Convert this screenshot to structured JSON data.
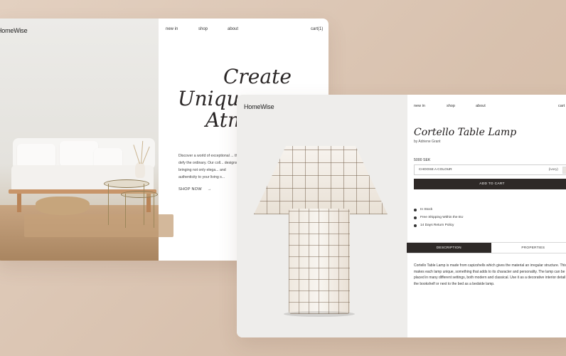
{
  "home": {
    "brand": "HomeWise",
    "nav": {
      "new_in": "new in",
      "shop": "shop",
      "about": "about",
      "cart": "cart(1)"
    },
    "headline": {
      "line1": "Create",
      "line2": "Unique",
      "line3": "Atm"
    },
    "body": "Discover a world of exceptional ... that defy the ordinary. Our coll... designs, bringing not only elega... and authenticity to your living s...",
    "shop_now": "SHOP NOW",
    "arrow_icon": "arrow-right-icon"
  },
  "product": {
    "brand": "HomeWise",
    "nav": {
      "new_in": "new in",
      "shop": "shop",
      "about": "about",
      "cart": "cart"
    },
    "title": "Cortello Table Lamp",
    "author": "by Adriene Grant",
    "price": "5000 SEK",
    "colour_select": {
      "label": "CHOOSE A COLOUR",
      "selected": "(ivory)"
    },
    "add_to_cart": "ADD TO CART",
    "features": [
      "In Stock",
      "Free Shipping Within the EU",
      "14 Days Return Policy"
    ],
    "tabs": [
      "DESCRIPTION",
      "PROPERTIES"
    ],
    "active_tab": "DESCRIPTION",
    "description": "Cortello Table Lamp is made from capizshells which gives the material an irregular structure. This makes each lamp unique, something that adds to its character and personality. The lamp can be placed in many different settings, both modern and classical. Use it as a decorative interior detail in the bookshelf or next to the bed as a bedside lamp."
  },
  "colors": {
    "accent_dark": "#2e2927",
    "background": "#dcc6b4"
  }
}
